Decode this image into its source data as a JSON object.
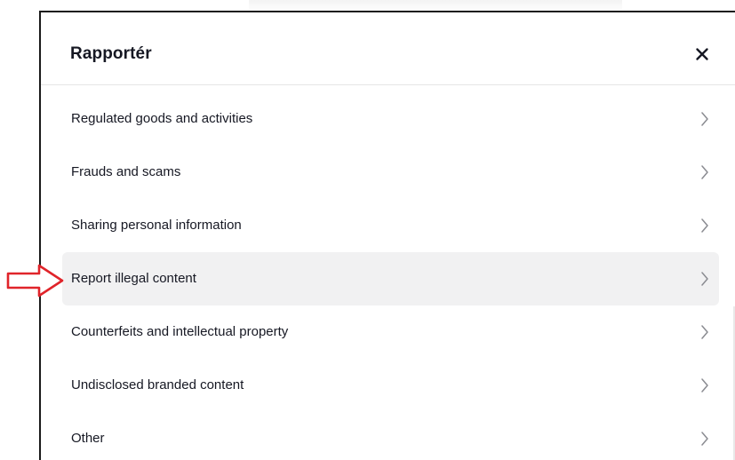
{
  "dialog": {
    "title": "Rapportér",
    "close_icon": "close-icon"
  },
  "menu": {
    "items": [
      {
        "label": "Regulated goods and activities",
        "highlighted": false
      },
      {
        "label": "Frauds and scams",
        "highlighted": false
      },
      {
        "label": "Sharing personal information",
        "highlighted": false
      },
      {
        "label": "Report illegal content",
        "highlighted": true
      },
      {
        "label": "Counterfeits and intellectual property",
        "highlighted": false
      },
      {
        "label": "Undisclosed branded content",
        "highlighted": false
      },
      {
        "label": "Other",
        "highlighted": false
      }
    ],
    "item_icon": "chevron-right-icon"
  },
  "annotation": {
    "icon": "arrow-right-icon",
    "color": "#e0242a"
  },
  "colors": {
    "text": "#161823",
    "highlight_bg": "#f1f1f2",
    "chevron": "#8a8b91"
  }
}
